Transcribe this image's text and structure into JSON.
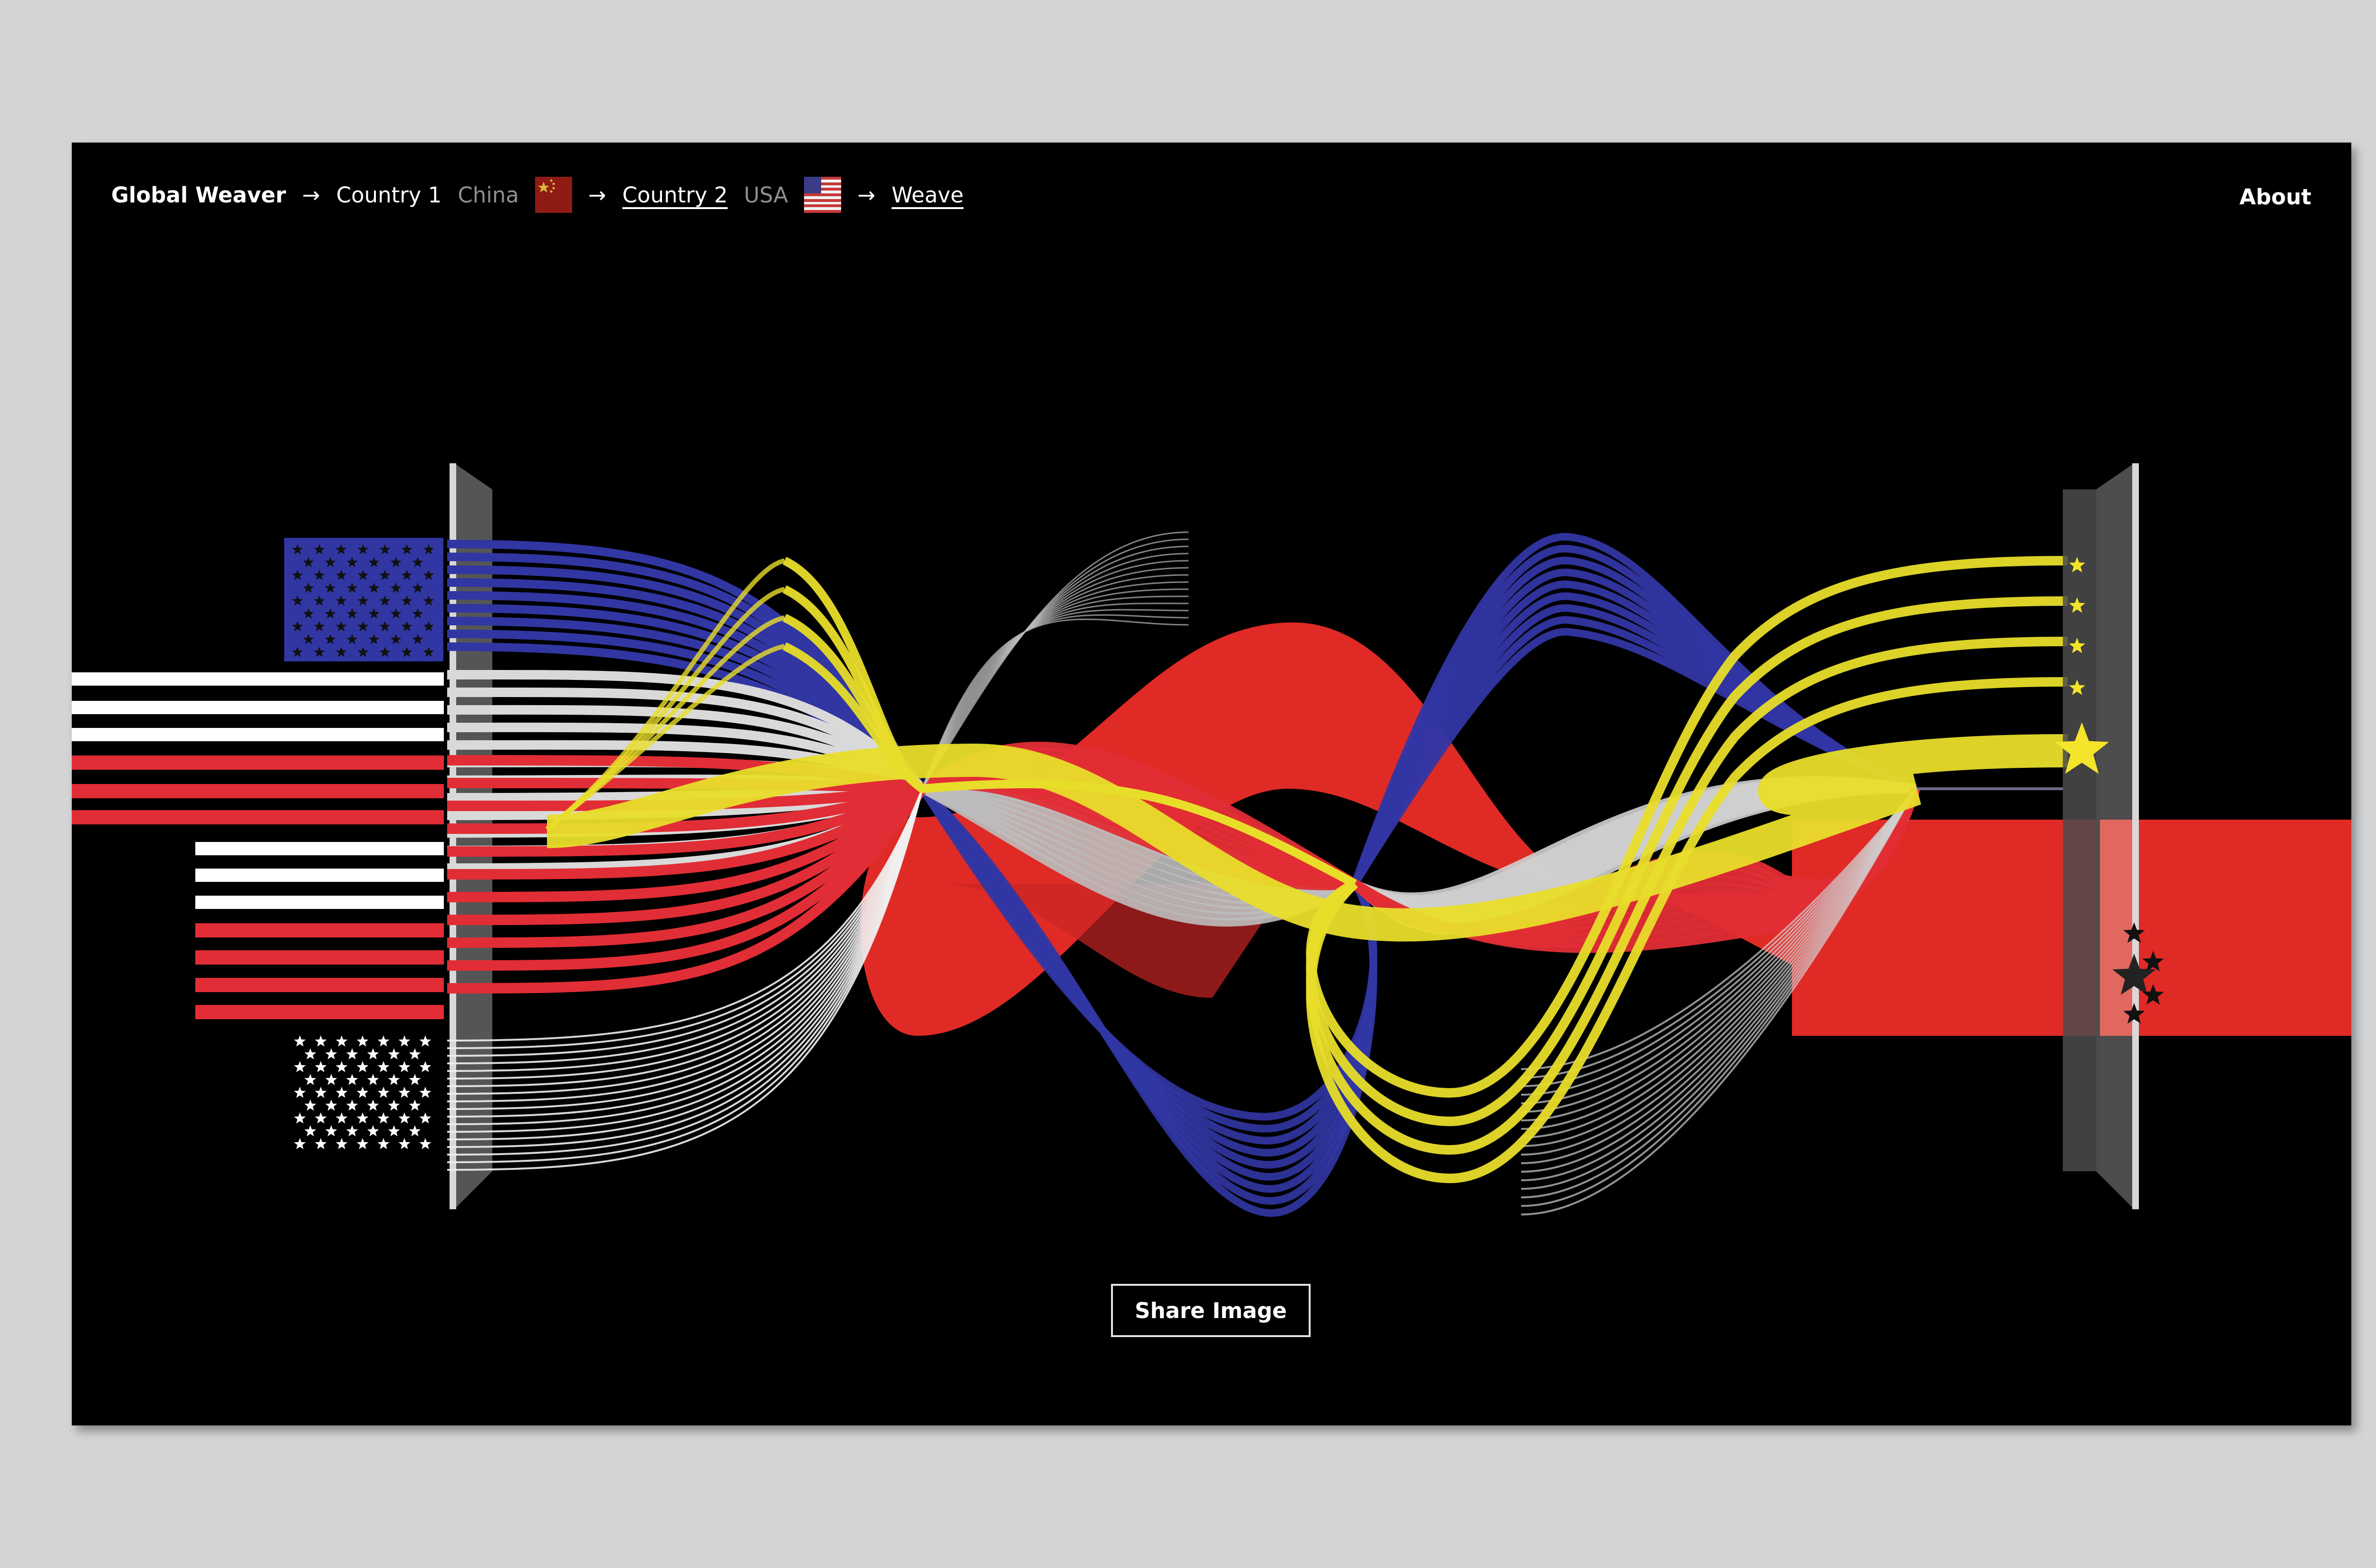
{
  "breadcrumb": {
    "app_title": "Global Weaver",
    "arrow": "→",
    "country1_label": "Country 1",
    "country1_value": "China",
    "country1_flag_icon": "china-flag-icon",
    "country2_label": "Country 2",
    "country2_value": "USA",
    "country2_flag_icon": "usa-flag-icon",
    "weave_label": "Weave"
  },
  "nav": {
    "about_label": "About"
  },
  "actions": {
    "share_label": "Share Image"
  },
  "colors": {
    "background": "#000000",
    "frame_bg": "#d3d4d6",
    "usa_blue": "#3136a3",
    "usa_red": "#e12d35",
    "usa_white": "#ffffff",
    "china_red": "#e02a26",
    "china_yellow": "#f5e52a",
    "panel_grey": "#555555"
  }
}
